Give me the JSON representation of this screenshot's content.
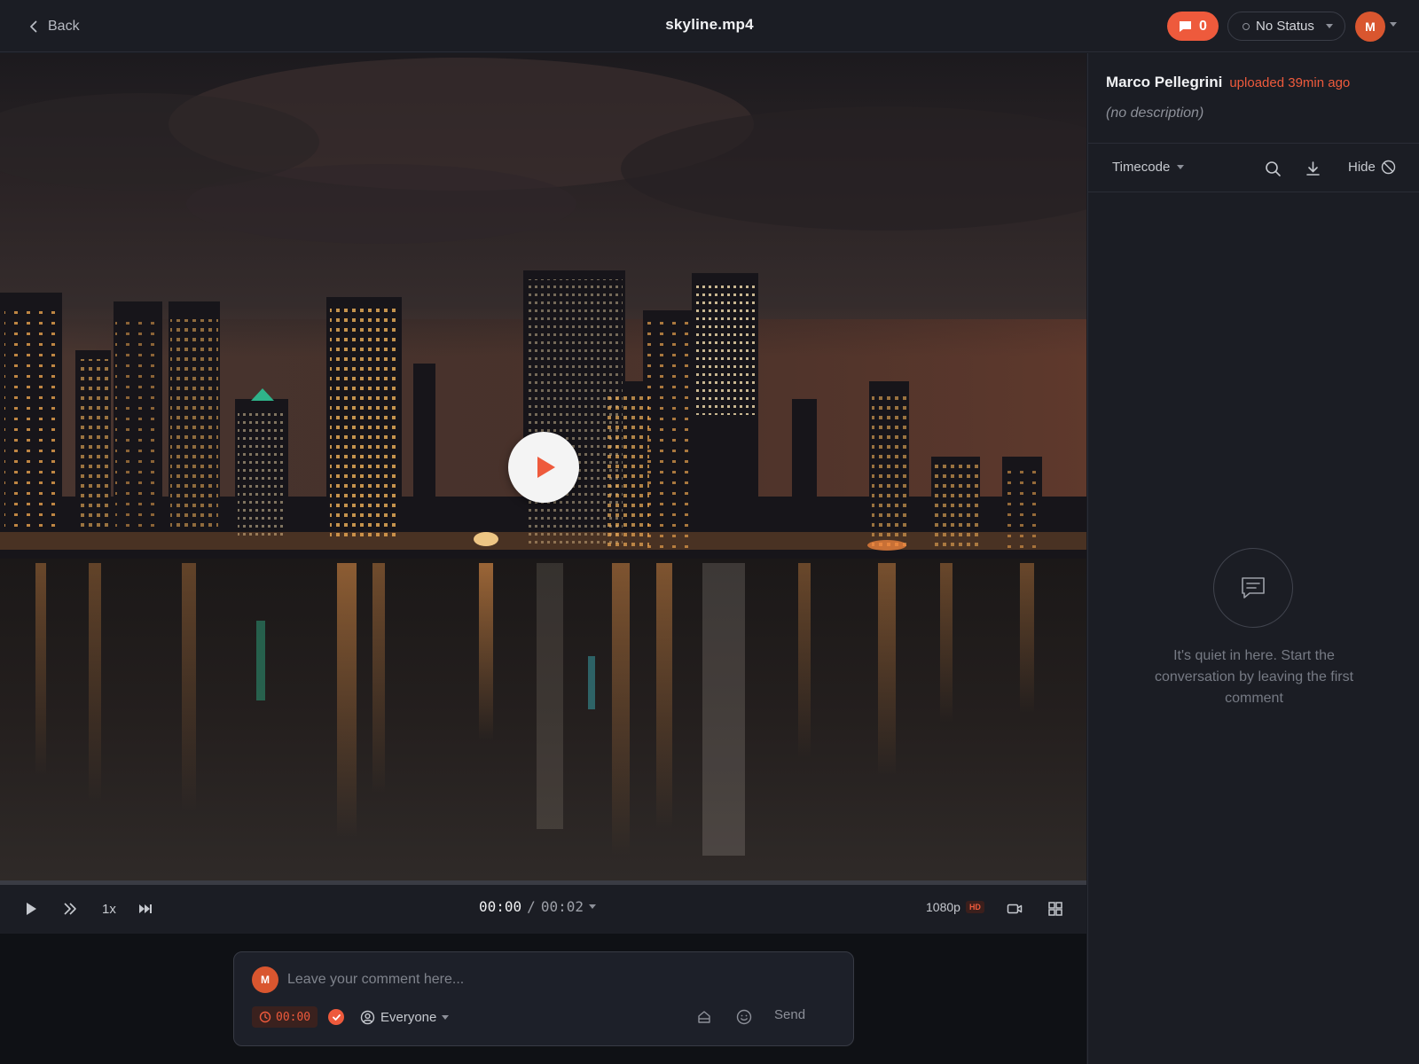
{
  "header": {
    "back_label": "Back",
    "title": "skyline.mp4",
    "comment_count": "0",
    "status_label": "No Status",
    "avatar_initial": "M"
  },
  "player": {
    "current_time": "00:00",
    "separator": "/",
    "total_time": "00:02",
    "speed": "1x",
    "quality": "1080p",
    "quality_badge": "HD",
    "progress": 0
  },
  "composer": {
    "avatar_initial": "M",
    "placeholder": "Leave your comment here...",
    "timecode": "00:00",
    "audience": "Everyone",
    "send_label": "Send"
  },
  "sidebar": {
    "uploader_name": "Marco Pellegrini",
    "uploaded_text": "uploaded 39min ago",
    "description": "(no description)",
    "timecode_label": "Timecode",
    "hide_label": "Hide",
    "empty_message": "It's quiet in here. Start the conversation by leaving the first comment"
  },
  "colors": {
    "accent": "#ee5a3c",
    "background": "#1b1d24",
    "panel": "#1b1d24"
  },
  "icons": [
    "chevron-left-icon",
    "comment-icon",
    "status-dot-icon",
    "play-icon",
    "skip-icon",
    "next-frame-icon",
    "camera-icon",
    "grid-icon",
    "clock-icon",
    "check-icon",
    "user-circle-icon",
    "attachment-icon",
    "emoji-icon",
    "search-icon",
    "download-icon",
    "hide-icon",
    "chat-bubble-icon"
  ]
}
